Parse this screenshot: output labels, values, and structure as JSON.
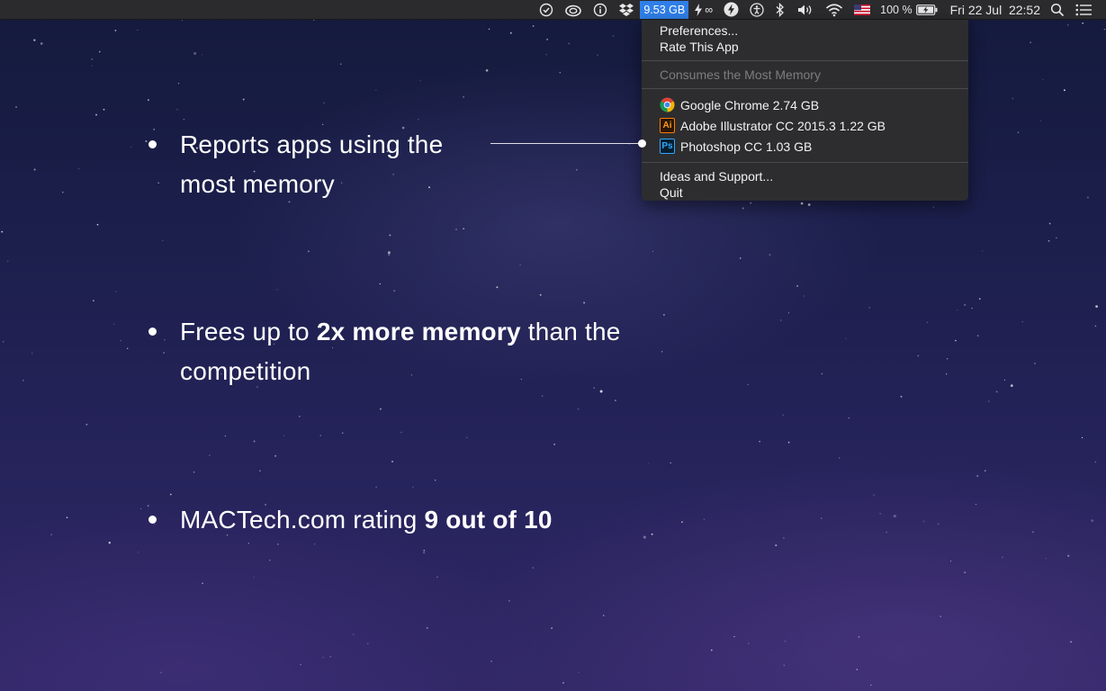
{
  "menubar": {
    "memory_usage": "9.53 GB",
    "extra_symbol": "∞",
    "battery_percent": "100 %",
    "datetime": "Fri 22 Jul  22:52"
  },
  "menu": {
    "preferences": "Preferences...",
    "rate_app": "Rate This App",
    "section_header": "Consumes the Most Memory",
    "apps": [
      {
        "icon": "chrome-icon",
        "label": "Google Chrome 2.74 GB"
      },
      {
        "icon": "illustrator-icon",
        "icon_text": "Ai",
        "label": "Adobe Illustrator CC 2015.3 1.22 GB"
      },
      {
        "icon": "photoshop-icon",
        "icon_text": "Ps",
        "label": "Photoshop CC 1.03 GB"
      }
    ],
    "ideas_support": "Ideas and Support...",
    "quit": "Quit"
  },
  "features": {
    "b1": "Reports apps using the most memory",
    "b2_pre": "Frees up to ",
    "b2_bold": "2x more memory",
    "b2_post": " than the competition",
    "b3_pre": "MACTech.com rating ",
    "b3_bold": "9 out of 10"
  },
  "colors": {
    "menubar_bg": "#2b2b2d",
    "menu_bg": "#2d2d2f",
    "memory_badge": "#2f7fe8",
    "background_top": "#141a3c",
    "background_bottom": "#2f2765"
  }
}
